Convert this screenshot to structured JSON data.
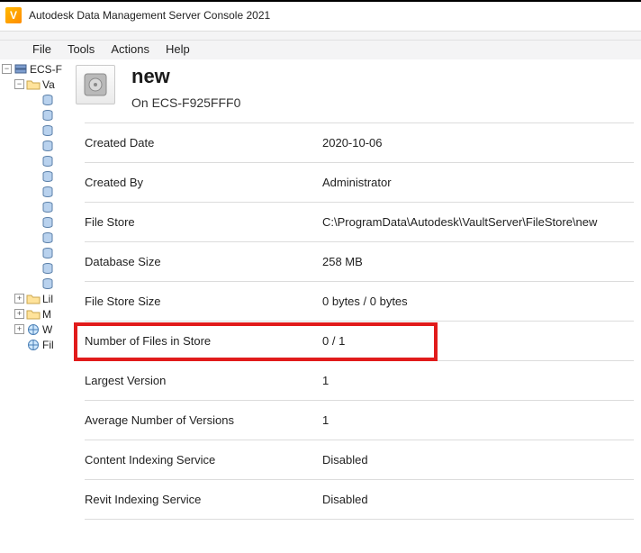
{
  "window": {
    "title": "Autodesk Data Management Server Console 2021"
  },
  "menu": {
    "file": "File",
    "tools": "Tools",
    "actions": "Actions",
    "help": "Help"
  },
  "tree": {
    "root": "ECS-F",
    "vaults_folder": "Va",
    "vault_items": [
      "",
      "",
      "",
      "",
      "",
      "",
      "",
      "",
      "",
      "",
      "",
      "",
      ""
    ],
    "libraries": "Lil",
    "management": "M",
    "workgroups": "W",
    "filestores": "Fil"
  },
  "header": {
    "title": "new",
    "subtitle_prefix": "On ",
    "server": "ECS-F925FFF0"
  },
  "props": [
    {
      "label": "Created Date",
      "value": "2020-10-06"
    },
    {
      "label": "Created By",
      "value": "Administrator"
    },
    {
      "label": "File Store",
      "value": "C:\\ProgramData\\Autodesk\\VaultServer\\FileStore\\new"
    },
    {
      "label": "Database Size",
      "value": "258 MB"
    },
    {
      "label": "File Store Size",
      "value": "0 bytes / 0 bytes"
    },
    {
      "label": "Number of Files in Store",
      "value": "0 / 1",
      "highlight": true
    },
    {
      "label": "Largest Version",
      "value": "1"
    },
    {
      "label": "Average Number of Versions",
      "value": "1"
    },
    {
      "label": "Content Indexing Service",
      "value": "Disabled"
    },
    {
      "label": "Revit Indexing Service",
      "value": "Disabled"
    }
  ]
}
